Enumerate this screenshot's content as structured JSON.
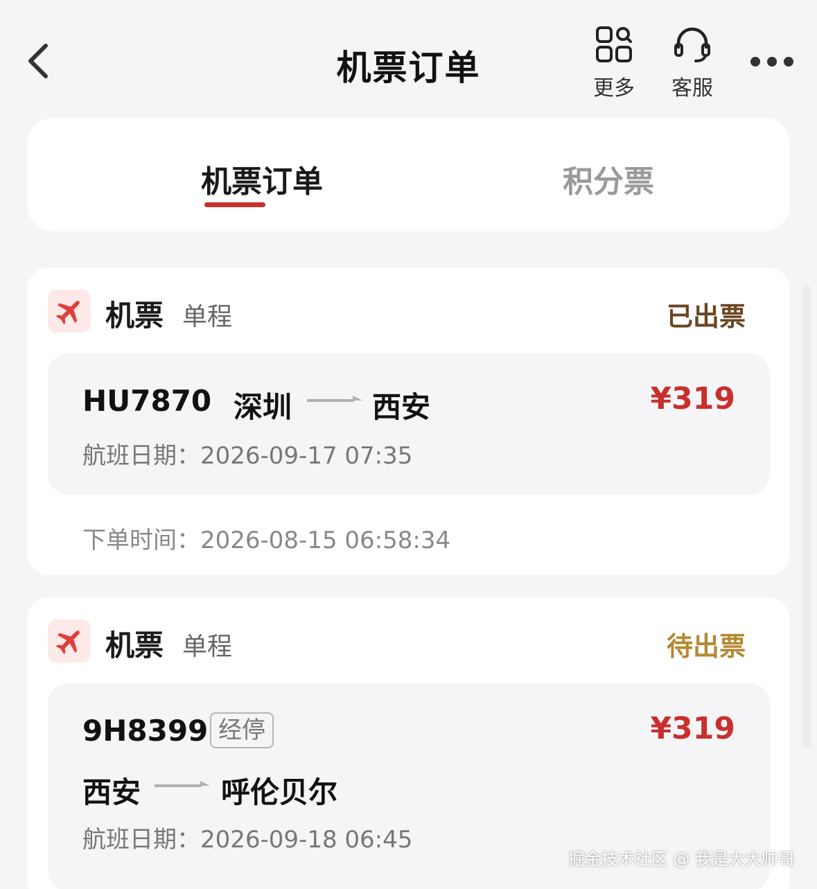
{
  "header": {
    "title": "机票订单",
    "more_label": "更多",
    "service_label": "客服"
  },
  "tabs": [
    {
      "label": "机票订单",
      "active": true
    },
    {
      "label": "积分票",
      "active": false
    }
  ],
  "orders": [
    {
      "type": "机票",
      "trip": "单程",
      "status": "已出票",
      "flight_no": "HU7870",
      "from": "深圳",
      "to": "西安",
      "price": "¥319",
      "flight_date": "航班日期：2026-09-17 07:35",
      "order_time": "下单时间：2026-08-15 06:58:34"
    },
    {
      "type": "机票",
      "trip": "单程",
      "status": "待出票",
      "flight_no": "9H8399",
      "stop_tag": "经停",
      "from": "西安",
      "to": "呼伦贝尔",
      "price": "¥319",
      "flight_date": "航班日期：2026-09-18 06:45"
    }
  ],
  "watermark": "掘金技术社区 @ 我是大大帅哥",
  "colors": {
    "accent": "#c9302c",
    "status_issued": "#6b4523",
    "status_pending": "#b38a33"
  }
}
